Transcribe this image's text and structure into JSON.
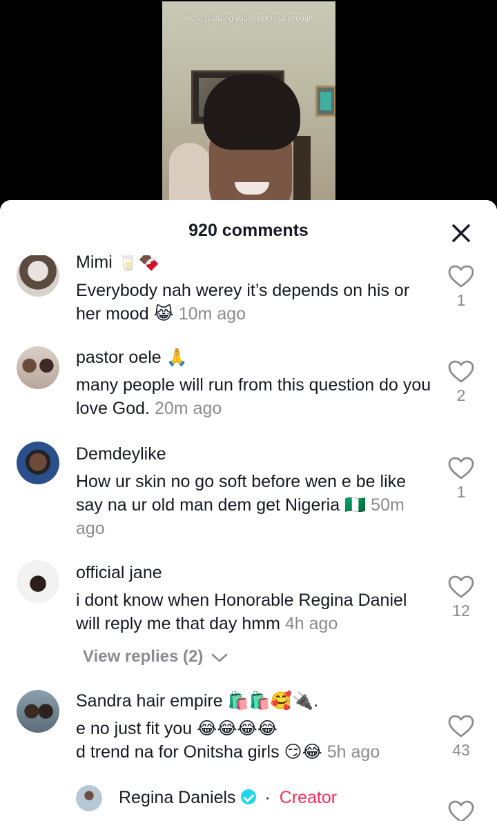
{
  "video": {
    "caption": "POV: realizing you're not mad enough"
  },
  "sheet": {
    "comments_count": "920 comments",
    "close_icon": "close-icon"
  },
  "comments": [
    {
      "username": "Mimi 🥛🍫",
      "text": "Everybody nah werey it’s depends on his or her mood 😹",
      "time": "10m ago",
      "likes": "1"
    },
    {
      "username": "pastor oele 🙏",
      "text": "many people will run from this question do you love God.",
      "time": "20m ago",
      "likes": "2"
    },
    {
      "username": "Demdeylike",
      "text": "How ur skin no go soft before wen e be like say na ur old man dem get Nigeria 🇳🇬",
      "time": "50m ago",
      "likes": "1"
    },
    {
      "username": "official jane",
      "text": "i dont know when Honorable Regina Daniel will reply me that day hmm",
      "time": "4h ago",
      "likes": "12",
      "view_replies": "View replies (2)"
    },
    {
      "username": "Sandra hair empire 🛍️🛍️🥰🔌.",
      "text_line1": "e no just fit you 😂😂😂😂",
      "text_line2": "d trend na for Onitsha girls 😏😂",
      "time": "5h ago",
      "likes": "43"
    }
  ],
  "reply": {
    "username": "Regina Daniels",
    "separator": "·",
    "badge": "Creator",
    "verified_icon": "verified-badge-icon"
  },
  "colors": {
    "accent_creator": "#fe2c55",
    "verified": "#20d5ec",
    "text": "#161823",
    "secondary": "#8a8b91"
  }
}
